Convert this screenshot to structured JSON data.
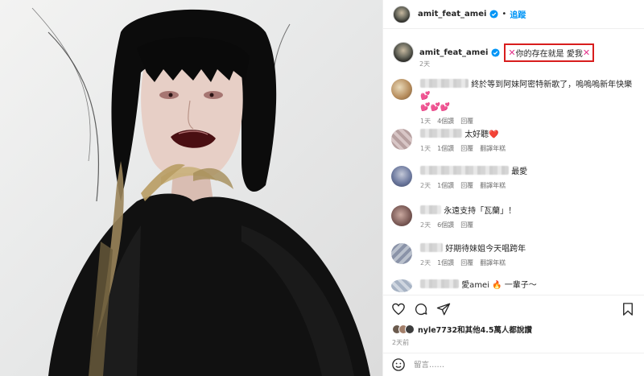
{
  "post": {
    "username": "amit_feat_amei",
    "follow_label": "追蹤",
    "separator": "•",
    "caption_prefix_icon": "cross-mark-icon",
    "caption_text": "你的存在就是 愛我",
    "caption_time": "2天",
    "likes_text": "nyle7732和其他4.5萬人都說讚",
    "post_time": "2天前",
    "comment_placeholder": "留言……"
  },
  "comments": [
    {
      "text": "終於等到阿妹阿密特新歌了，嗚嗚嗚新年快樂💕",
      "line2": "💕💕💕",
      "time": "1天",
      "likes": "4個讚",
      "reply": "回覆",
      "hidden": ""
    },
    {
      "text": "太好聽❤️",
      "time": "1天",
      "likes": "1個讚",
      "reply": "回覆",
      "hidden": "翻譯年糕"
    },
    {
      "text": "最愛",
      "time": "2天",
      "likes": "1個讚",
      "reply": "回覆",
      "hidden": "翻譯年糕"
    },
    {
      "text": "永遠支持「瓦蘭」！",
      "time": "2天",
      "likes": "6個讚",
      "reply": "回覆",
      "hidden": ""
    },
    {
      "text": "好期待妹姐今天唱跨年",
      "time": "2天",
      "likes": "1個讚",
      "reply": "回覆",
      "hidden": "翻譯年糕"
    },
    {
      "text": "愛amei 🔥 一輩子～",
      "time": "",
      "likes": "",
      "reply": "",
      "hidden": ""
    }
  ],
  "icons": {
    "like": "heart-icon",
    "comment": "comment-bubble-icon",
    "share": "paper-plane-icon",
    "save": "bookmark-icon",
    "emoji": "smiley-icon",
    "verified": "verified-badge-icon"
  },
  "colors": {
    "accent": "#0095f6",
    "highlight_border": "#d81d1d",
    "cross_mark": "#e3308a",
    "muted": "#8e8e8e"
  }
}
